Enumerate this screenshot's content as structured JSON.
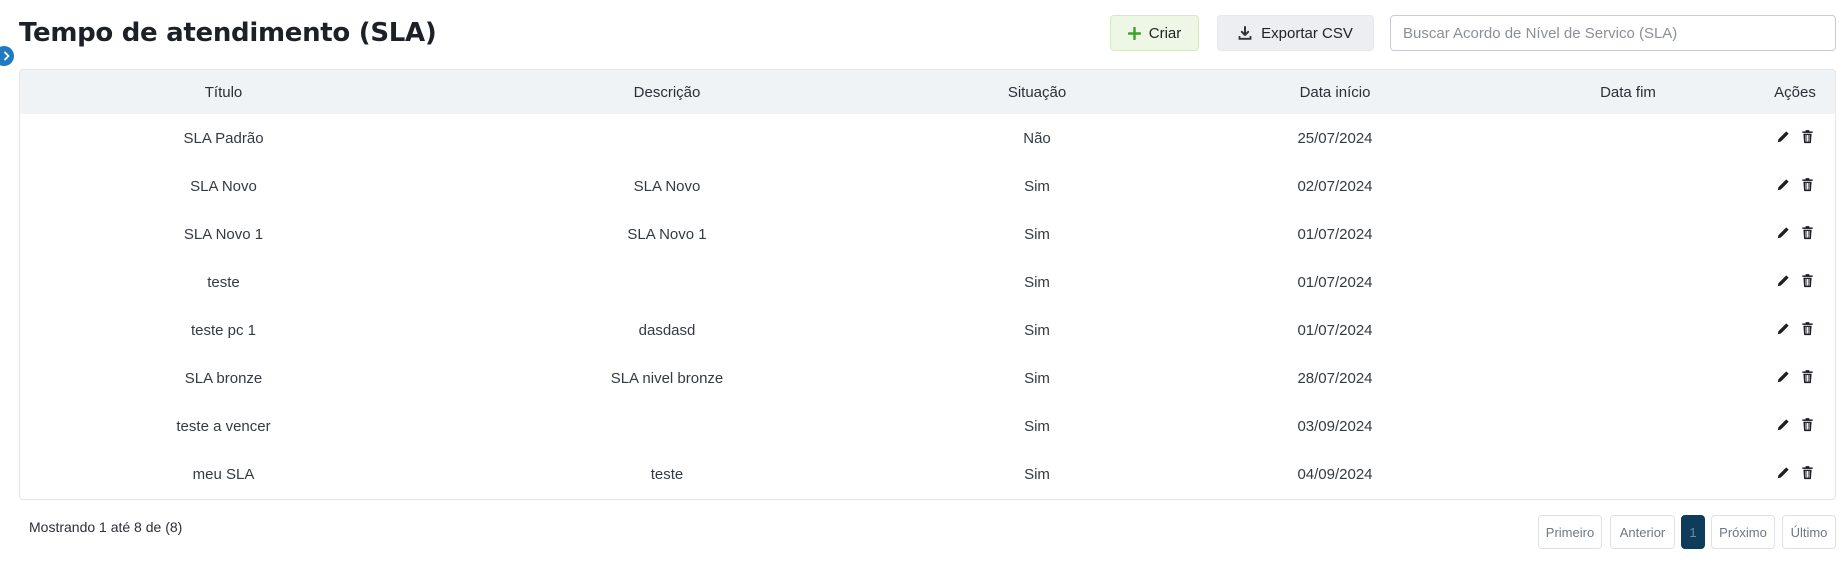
{
  "header": {
    "title": "Tempo de atendimento (SLA)",
    "create_label": "Criar",
    "export_label": "Exportar CSV",
    "search_placeholder": "Buscar Acordo de Nível de Servico (SLA)"
  },
  "table": {
    "columns": [
      "Título",
      "Descrição",
      "Situação",
      "Data início",
      "Data fim",
      "Ações"
    ],
    "rows": [
      {
        "titulo": "SLA Padrão",
        "descricao": "",
        "situacao": "Não",
        "inicio": "25/07/2024",
        "fim": ""
      },
      {
        "titulo": "SLA Novo",
        "descricao": "SLA Novo",
        "situacao": "Sim",
        "inicio": "02/07/2024",
        "fim": ""
      },
      {
        "titulo": "SLA Novo 1",
        "descricao": "SLA Novo 1",
        "situacao": "Sim",
        "inicio": "01/07/2024",
        "fim": ""
      },
      {
        "titulo": "teste",
        "descricao": "",
        "situacao": "Sim",
        "inicio": "01/07/2024",
        "fim": ""
      },
      {
        "titulo": "teste pc 1",
        "descricao": "dasdasd",
        "situacao": "Sim",
        "inicio": "01/07/2024",
        "fim": ""
      },
      {
        "titulo": "SLA bronze",
        "descricao": "SLA nivel bronze",
        "situacao": "Sim",
        "inicio": "28/07/2024",
        "fim": ""
      },
      {
        "titulo": "teste a vencer",
        "descricao": "",
        "situacao": "Sim",
        "inicio": "03/09/2024",
        "fim": ""
      },
      {
        "titulo": "meu SLA",
        "descricao": "teste",
        "situacao": "Sim",
        "inicio": "04/09/2024",
        "fim": ""
      }
    ]
  },
  "footer": {
    "info": "Mostrando 1 até 8 de (8)",
    "pagination": {
      "first": "Primeiro",
      "prev": "Anterior",
      "current": "1",
      "next": "Próximo",
      "last": "Último"
    }
  },
  "icons": {
    "sidebar_toggle": "chevron-right-icon",
    "create": "plus-icon",
    "export": "download-icon",
    "edit": "pencil-icon",
    "delete": "trash-icon"
  },
  "colors": {
    "accent": "#1f7ac4",
    "create_plus": "#3aa12e",
    "pager_active": "#0e3d5c"
  }
}
